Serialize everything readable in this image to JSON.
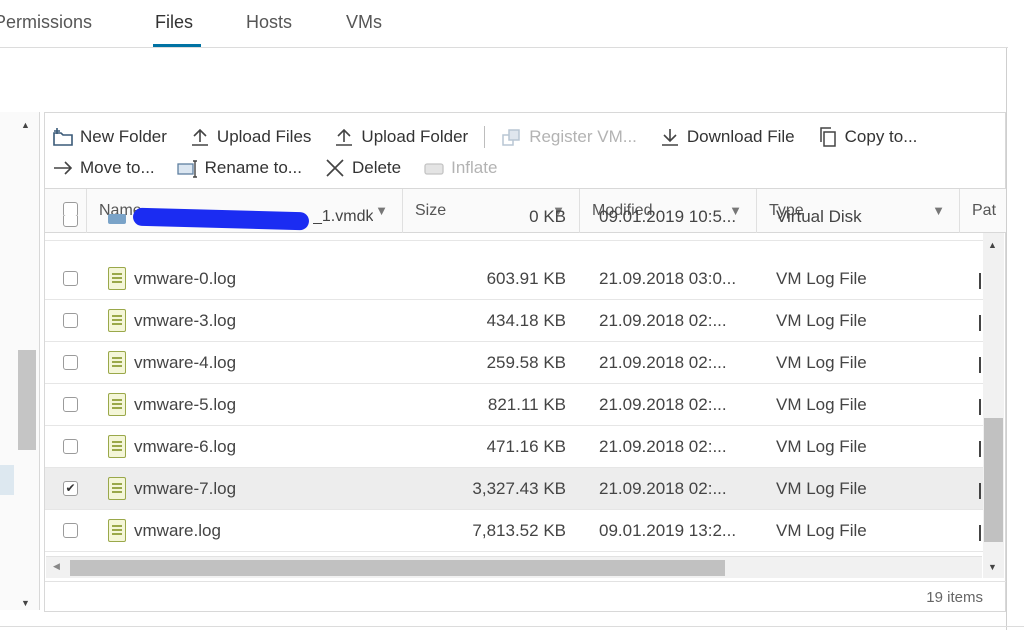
{
  "tabs": [
    {
      "label": "Permissions"
    },
    {
      "label": "Files"
    },
    {
      "label": "Hosts"
    },
    {
      "label": "VMs"
    }
  ],
  "active_tab": "Files",
  "toolbar": {
    "new_folder": "New Folder",
    "upload_files": "Upload Files",
    "upload_folder": "Upload Folder",
    "register_vm": "Register VM...",
    "download_file": "Download File",
    "copy_to": "Copy to...",
    "move_to": "Move to...",
    "rename_to": "Rename to...",
    "delete": "Delete",
    "inflate": "Inflate"
  },
  "columns": {
    "name": "Name",
    "size": "Size",
    "modified": "Modified",
    "type": "Type",
    "path": "Pat"
  },
  "rows": [
    {
      "name_suffix": "_1.vmdk",
      "size": "0 KB",
      "modified": "09.01.2019 10:5...",
      "type": "Virtual Disk",
      "checked": false,
      "redacted": true
    },
    {
      "name": "vmware-0.log",
      "size": "603.91 KB",
      "modified": "21.09.2018 03:0...",
      "type": "VM Log File",
      "checked": false
    },
    {
      "name": "vmware-3.log",
      "size": "434.18 KB",
      "modified": "21.09.2018 02:...",
      "type": "VM Log File",
      "checked": false
    },
    {
      "name": "vmware-4.log",
      "size": "259.58 KB",
      "modified": "21.09.2018 02:...",
      "type": "VM Log File",
      "checked": false
    },
    {
      "name": "vmware-5.log",
      "size": "821.11 KB",
      "modified": "21.09.2018 02:...",
      "type": "VM Log File",
      "checked": false
    },
    {
      "name": "vmware-6.log",
      "size": "471.16 KB",
      "modified": "21.09.2018 02:...",
      "type": "VM Log File",
      "checked": false
    },
    {
      "name": "vmware-7.log",
      "size": "3,327.43 KB",
      "modified": "21.09.2018 02:...",
      "type": "VM Log File",
      "checked": true
    },
    {
      "name": "vmware.log",
      "size": "7,813.52 KB",
      "modified": "09.01.2019 13:2...",
      "type": "VM Log File",
      "checked": false
    }
  ],
  "footer": {
    "items_count": "19 items"
  },
  "colors": {
    "accent": "#0072a3",
    "selected_row": "#ededed",
    "log_icon": "#9aa84a"
  }
}
